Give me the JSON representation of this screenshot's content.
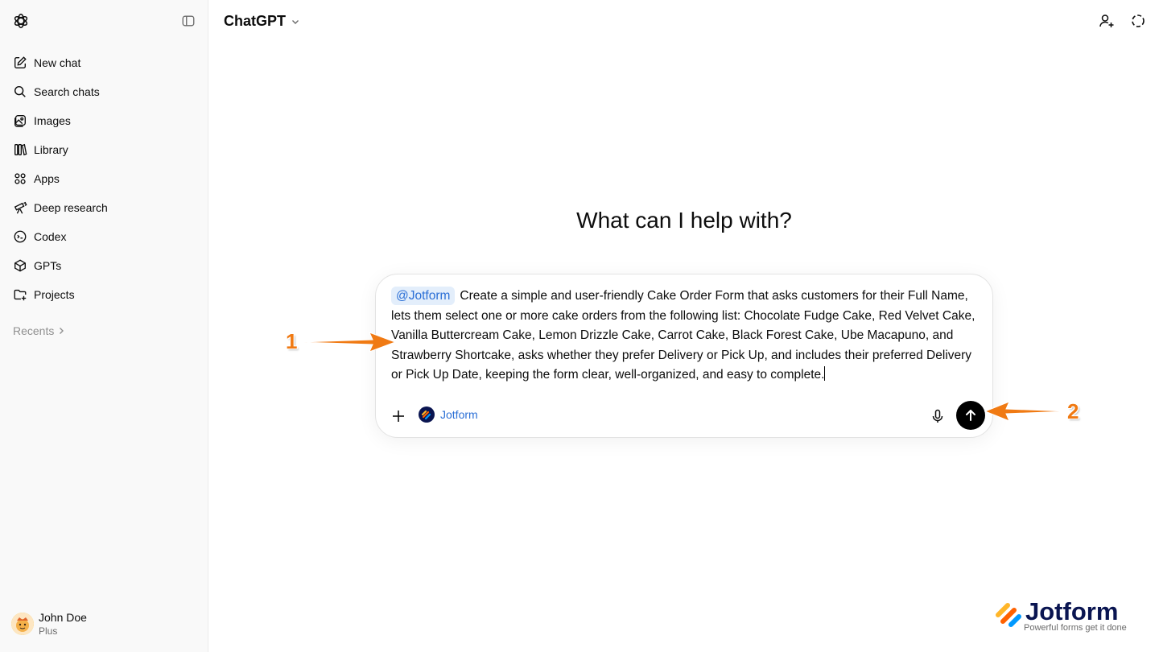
{
  "sidebar": {
    "items": [
      {
        "label": "New chat",
        "icon": "new-chat-icon"
      },
      {
        "label": "Search chats",
        "icon": "search-icon"
      },
      {
        "label": "Images",
        "icon": "images-icon"
      },
      {
        "label": "Library",
        "icon": "library-icon"
      },
      {
        "label": "Apps",
        "icon": "apps-icon"
      },
      {
        "label": "Deep research",
        "icon": "telescope-icon"
      },
      {
        "label": "Codex",
        "icon": "codex-icon"
      },
      {
        "label": "GPTs",
        "icon": "cube-icon"
      },
      {
        "label": "Projects",
        "icon": "folder-plus-icon"
      }
    ],
    "recents_label": "Recents",
    "user": {
      "name": "John Doe",
      "plan": "Plus"
    }
  },
  "header": {
    "model": "ChatGPT"
  },
  "main": {
    "heading": "What can I help with?",
    "composer": {
      "mention": "@Jotform",
      "prompt_text": "Create a simple and user-friendly Cake Order Form that asks customers for their Full Name, lets them select one or more cake orders from the following list: Chocolate Fudge Cake, Red Velvet Cake, Vanilla Buttercream Cake, Lemon Drizzle Cake, Carrot Cake, Black Forest Cake, Ube Macapuno, and Strawberry Shortcake, asks whether they prefer Delivery or Pick Up, and includes their preferred Delivery or Pick Up Date, keeping the form clear, well-organized, and easy to complete.",
      "app_chip": "Jotform"
    }
  },
  "annotations": {
    "arrow_1": "1",
    "arrow_2": "2"
  },
  "watermark": {
    "brand": "Jotform",
    "tagline": "Powerful forms get it done"
  },
  "colors": {
    "accent_orange": "#f07a13",
    "mention_blue": "#2b6fd6",
    "jotform_navy": "#0a1551"
  }
}
